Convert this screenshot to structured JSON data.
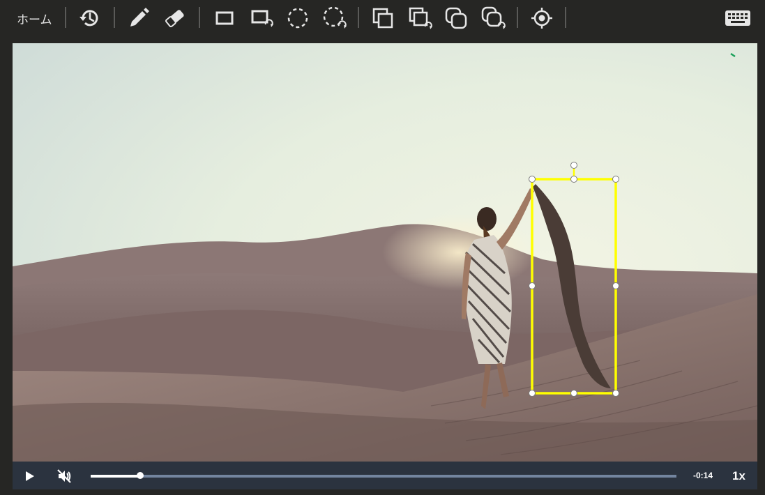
{
  "toolbar": {
    "home_label": "ホーム",
    "tools": [
      {
        "icon": "history-icon"
      },
      {
        "icon": "pencil-icon"
      },
      {
        "icon": "eraser-icon"
      },
      {
        "icon": "rectangle-icon"
      },
      {
        "icon": "rectangle-repeat-icon"
      },
      {
        "icon": "dashed-circle-icon"
      },
      {
        "icon": "dashed-circle-repeat-icon"
      },
      {
        "icon": "copy-rectangle-icon"
      },
      {
        "icon": "copy-rectangle-repeat-icon"
      },
      {
        "icon": "copy-rounded-icon"
      },
      {
        "icon": "copy-rounded-repeat-icon"
      },
      {
        "icon": "target-icon"
      },
      {
        "icon": "keyboard-icon"
      }
    ]
  },
  "annotation": {
    "color": "#ffff00",
    "handle_color": "#ffffff"
  },
  "player": {
    "play_icon": "play-icon",
    "mute_icon": "muted-speaker-icon",
    "remaining_time": "-0:14",
    "playback_rate": "1x",
    "progress": 0.084
  }
}
